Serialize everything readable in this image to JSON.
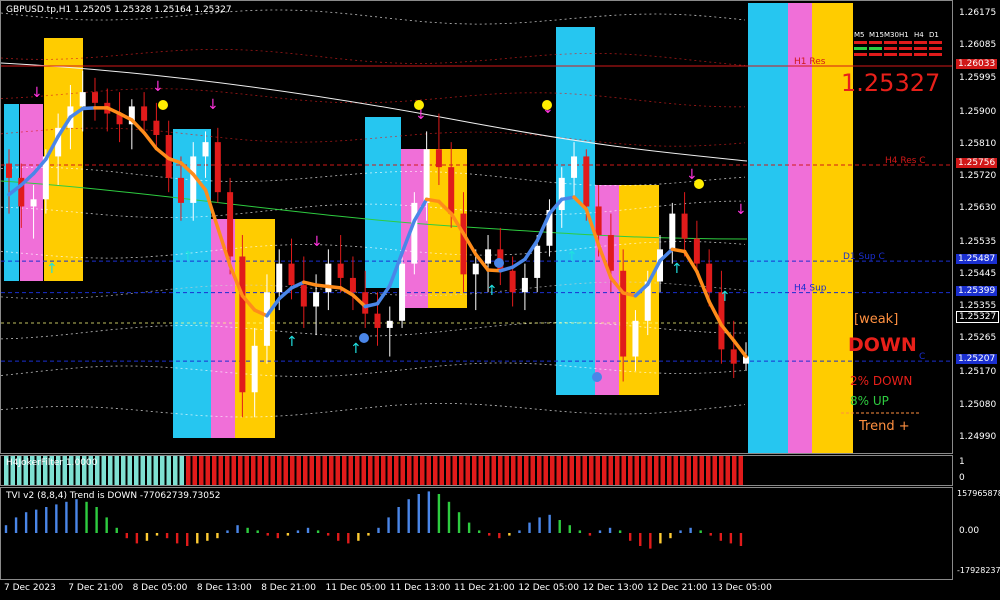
{
  "chart_data": [
    {
      "type": "candlestick",
      "title": "GBPUSD.tp,H1  1.25205 1.25328 1.25164 1.25327",
      "y_ticks": [
        "1.26175",
        "1.26085",
        "1.25995",
        "1.25900",
        "1.25810",
        "1.25720",
        "1.25630",
        "1.25535",
        "1.25445",
        "1.25355",
        "1.25265",
        "1.25170",
        "1.25080",
        "1.24990"
      ],
      "ylim": [
        1.2495,
        1.26215
      ],
      "x_ticks": [
        "7 Dec 2023",
        "7 Dec 21:00",
        "8 Dec 05:00",
        "8 Dec 13:00",
        "8 Dec 21:00",
        "11 Dec 05:00",
        "11 Dec 13:00",
        "11 Dec 21:00",
        "12 Dec 05:00",
        "12 Dec 13:00",
        "12 Dec 21:00",
        "13 Dec 05:00"
      ],
      "current_price": "1.25327",
      "big_price": "1.25327",
      "price_tags": [
        {
          "label": "1.26033",
          "value": 1.26033,
          "color": "#d01818"
        },
        {
          "label": "1.25756",
          "value": 1.25756,
          "color": "#d01818"
        },
        {
          "label": "1.25487",
          "value": 1.25487,
          "color": "#1a2fd0"
        },
        {
          "label": "1.25399",
          "value": 1.25399,
          "color": "#1a2fd0"
        },
        {
          "label": "1.25327",
          "value": 1.25327,
          "color": "#000000"
        },
        {
          "label": "1.25207",
          "value": 1.25207,
          "color": "#1a2fd0"
        }
      ],
      "levels": [
        {
          "label": "H1 Res",
          "value": 1.26033,
          "color": "#d01818"
        },
        {
          "label": "H4 Res C",
          "value": 1.25756,
          "color": "#d01818"
        },
        {
          "label": "D1 Sup C",
          "value": 1.25487,
          "color": "#1a2fd0"
        },
        {
          "label": "H4 Sup",
          "value": 1.25399,
          "color": "#1a2fd0"
        },
        {
          "label": "C",
          "value": 1.25207,
          "color": "#1a2fd0"
        }
      ],
      "signal": {
        "strength": "[weak]",
        "direction": "DOWN",
        "down_line": "2% DOWN",
        "down_color": "#e8201a",
        "up_line": "8% UP",
        "up_color": "#2ecc40",
        "trend": "Trend +"
      },
      "timeframes": [
        "M5",
        "M15",
        "M30",
        "H1",
        "H4",
        "D1"
      ],
      "candles": [
        [
          1.2576,
          1.258,
          1.2562,
          1.2572
        ],
        [
          1.2572,
          1.2576,
          1.2558,
          1.2564
        ],
        [
          1.2564,
          1.257,
          1.2555,
          1.2566
        ],
        [
          1.2566,
          1.258,
          1.2562,
          1.2578
        ],
        [
          1.2578,
          1.259,
          1.257,
          1.2586
        ],
        [
          1.2586,
          1.2598,
          1.258,
          1.2592
        ],
        [
          1.2592,
          1.2602,
          1.2585,
          1.2596
        ],
        [
          1.2596,
          1.26,
          1.2588,
          1.2593
        ],
        [
          1.2593,
          1.2597,
          1.2585,
          1.259
        ],
        [
          1.259,
          1.2596,
          1.2582,
          1.2587
        ],
        [
          1.2587,
          1.2594,
          1.258,
          1.2592
        ],
        [
          1.2592,
          1.2596,
          1.2584,
          1.2588
        ],
        [
          1.2588,
          1.2593,
          1.258,
          1.2584
        ],
        [
          1.2584,
          1.2588,
          1.2568,
          1.2572
        ],
        [
          1.2572,
          1.2578,
          1.256,
          1.2565
        ],
        [
          1.2565,
          1.2582,
          1.256,
          1.2578
        ],
        [
          1.2578,
          1.2585,
          1.2572,
          1.2582
        ],
        [
          1.2582,
          1.2586,
          1.2565,
          1.2568
        ],
        [
          1.2568,
          1.2572,
          1.2545,
          1.255
        ],
        [
          1.255,
          1.2556,
          1.2505,
          1.2512
        ],
        [
          1.2512,
          1.253,
          1.2505,
          1.2525
        ],
        [
          1.2525,
          1.2545,
          1.252,
          1.254
        ],
        [
          1.254,
          1.2552,
          1.2535,
          1.2548
        ],
        [
          1.2548,
          1.2555,
          1.2538,
          1.2542
        ],
        [
          1.2542,
          1.255,
          1.253,
          1.2536
        ],
        [
          1.2536,
          1.2545,
          1.2528,
          1.254
        ],
        [
          1.254,
          1.2552,
          1.2535,
          1.2548
        ],
        [
          1.2548,
          1.2556,
          1.254,
          1.2544
        ],
        [
          1.2544,
          1.255,
          1.2535,
          1.254
        ],
        [
          1.254,
          1.2546,
          1.253,
          1.2534
        ],
        [
          1.2534,
          1.254,
          1.2525,
          1.253
        ],
        [
          1.253,
          1.2536,
          1.2522,
          1.2532
        ],
        [
          1.2532,
          1.255,
          1.253,
          1.2548
        ],
        [
          1.2548,
          1.2568,
          1.2545,
          1.2565
        ],
        [
          1.2565,
          1.2585,
          1.256,
          1.258
        ],
        [
          1.258,
          1.259,
          1.257,
          1.2575
        ],
        [
          1.2575,
          1.2582,
          1.2558,
          1.2562
        ],
        [
          1.2562,
          1.2568,
          1.254,
          1.2545
        ],
        [
          1.2545,
          1.2552,
          1.2535,
          1.2548
        ],
        [
          1.2548,
          1.2556,
          1.254,
          1.2552
        ],
        [
          1.2552,
          1.2558,
          1.2542,
          1.2546
        ],
        [
          1.2546,
          1.255,
          1.2536,
          1.254
        ],
        [
          1.254,
          1.2548,
          1.2535,
          1.2544
        ],
        [
          1.2544,
          1.2556,
          1.254,
          1.2553
        ],
        [
          1.2553,
          1.2566,
          1.255,
          1.2563
        ],
        [
          1.2563,
          1.2575,
          1.2558,
          1.2572
        ],
        [
          1.2572,
          1.2582,
          1.2566,
          1.2578
        ],
        [
          1.2578,
          1.258,
          1.256,
          1.2564
        ],
        [
          1.2564,
          1.257,
          1.255,
          1.2556
        ],
        [
          1.2556,
          1.2562,
          1.254,
          1.2546
        ],
        [
          1.2546,
          1.2552,
          1.2515,
          1.2522
        ],
        [
          1.2522,
          1.2535,
          1.2518,
          1.2532
        ],
        [
          1.2532,
          1.2546,
          1.2528,
          1.2543
        ],
        [
          1.2543,
          1.2556,
          1.254,
          1.2552
        ],
        [
          1.2552,
          1.2565,
          1.2548,
          1.2562
        ],
        [
          1.2562,
          1.2568,
          1.255,
          1.2555
        ],
        [
          1.2555,
          1.256,
          1.2545,
          1.2548
        ],
        [
          1.2548,
          1.2552,
          1.2536,
          1.254
        ],
        [
          1.254,
          1.2546,
          1.252,
          1.2524
        ],
        [
          1.2524,
          1.2532,
          1.2516,
          1.252
        ],
        [
          1.252,
          1.2526,
          1.2518,
          1.2522
        ]
      ]
    },
    {
      "type": "bar",
      "title": "H4JokerFilter 1.0000",
      "y_ticks": [
        "1",
        "0"
      ],
      "series": [
        {
          "name": "up",
          "color": "#7fe0d2",
          "count": 28
        },
        {
          "name": "down",
          "color": "#e01b1b",
          "count": 86
        }
      ]
    },
    {
      "type": "bar",
      "title": "TVI v2 (8,8,4) Trend is DOWN -77062739.73052",
      "y_ticks": [
        "157965878",
        "0.00",
        "-17928237"
      ],
      "values": [
        0.3,
        0.6,
        0.8,
        0.9,
        1.0,
        1.1,
        1.2,
        1.3,
        1.2,
        1.0,
        0.6,
        0.2,
        -0.2,
        -0.4,
        -0.3,
        -0.1,
        -0.2,
        -0.4,
        -0.5,
        -0.4,
        -0.3,
        -0.2,
        0.1,
        0.3,
        0.2,
        0.1,
        -0.1,
        -0.2,
        -0.1,
        0.1,
        0.2,
        0.1,
        -0.1,
        -0.3,
        -0.4,
        -0.3,
        -0.1,
        0.2,
        0.6,
        1.0,
        1.3,
        1.5,
        1.6,
        1.5,
        1.2,
        0.8,
        0.4,
        0.1,
        -0.1,
        -0.2,
        -0.1,
        0.1,
        0.4,
        0.6,
        0.7,
        0.5,
        0.3,
        0.1,
        -0.1,
        0.1,
        0.2,
        0.1,
        -0.3,
        -0.5,
        -0.6,
        -0.4,
        -0.2,
        0.1,
        0.2,
        0.1,
        -0.1,
        -0.3,
        -0.4,
        -0.5
      ]
    }
  ]
}
